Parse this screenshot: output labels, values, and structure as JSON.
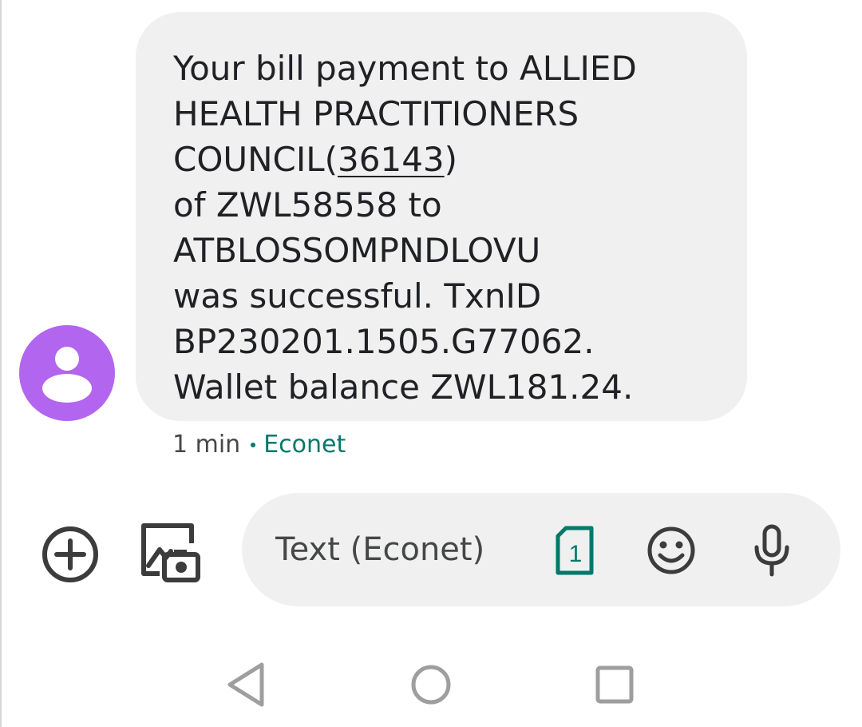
{
  "message": {
    "lines_before_link": [
      "Your bill payment to ALLIED",
      "HEALTH PRACTITIONERS"
    ],
    "link_line_prefix": "COUNCIL(",
    "link_text": "36143",
    "link_line_suffix": ")",
    "lines_after_link": [
      "of ZWL58558 to",
      "ATBLOSSOMPNDLOVU",
      "was successful. TxnID",
      "BP230201.1505.G77062.",
      "Wallet balance ZWL181.24."
    ],
    "time": "1 min",
    "carrier": "Econet"
  },
  "compose": {
    "placeholder": "Text (Econet)",
    "value": "",
    "sim_slot": "1"
  },
  "icons": {
    "avatar": "person-icon",
    "add": "add-circle-icon",
    "gallery": "gallery-camera-icon",
    "sim": "sim-card-icon",
    "emoji": "emoji-icon",
    "mic": "microphone-icon",
    "back": "back-triangle-icon",
    "home": "home-circle-icon",
    "recents": "recents-square-icon"
  },
  "colors": {
    "avatar_bg": "#b266ef",
    "bubble_bg": "#f0f0f0",
    "accent_teal": "#00796b",
    "text": "#202124"
  }
}
